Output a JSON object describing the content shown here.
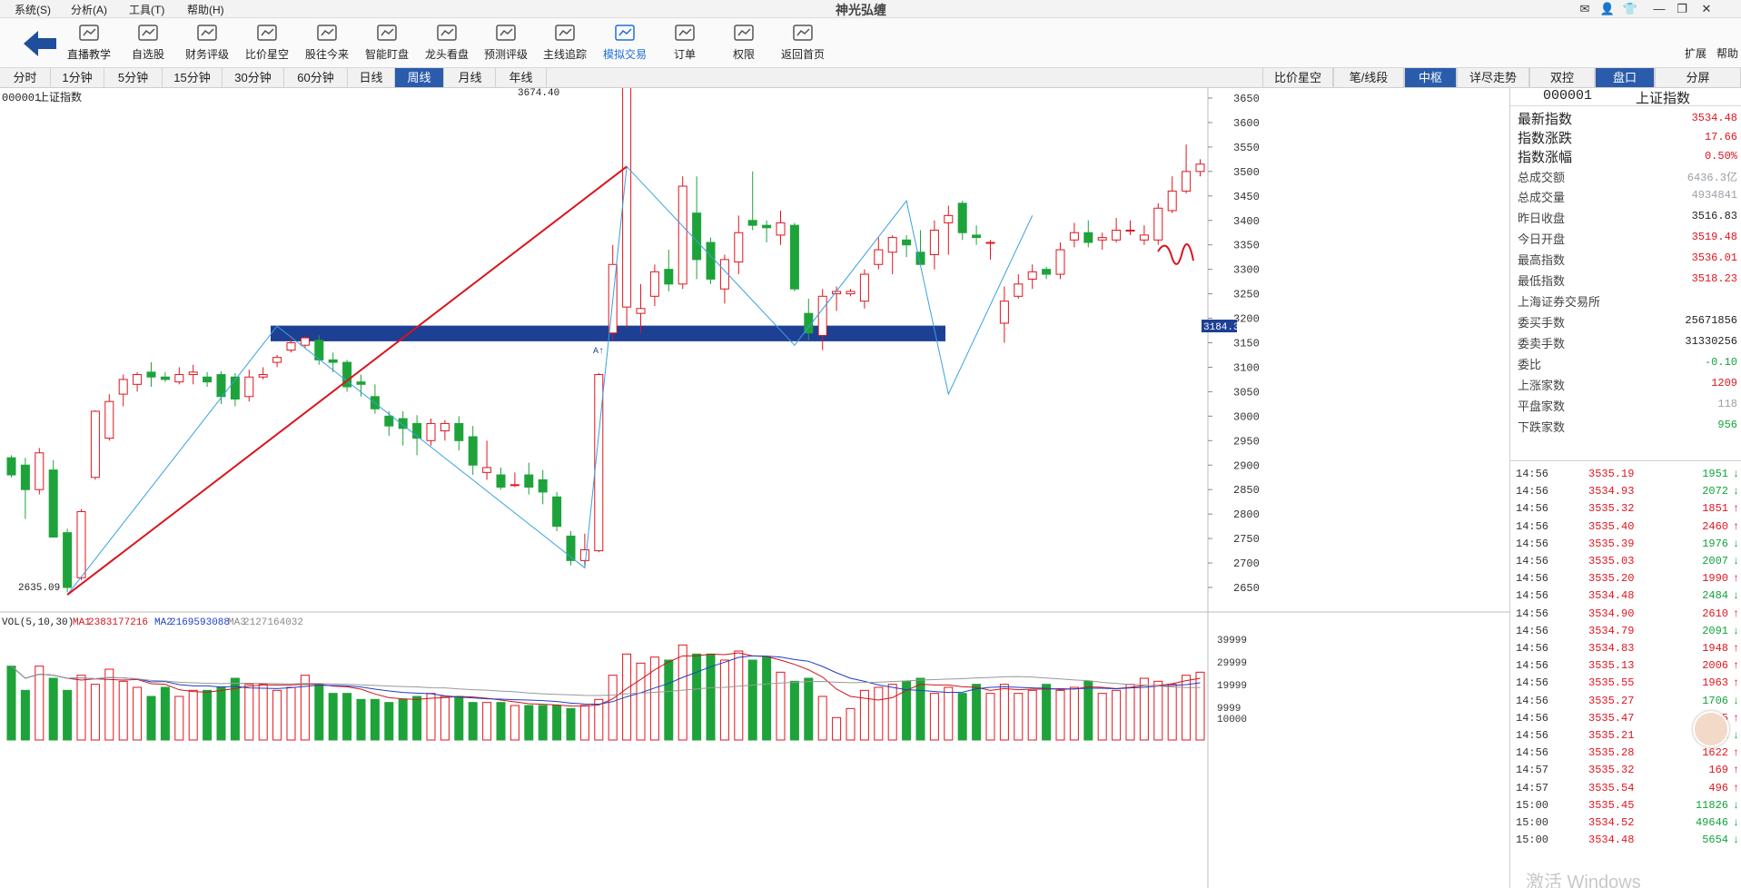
{
  "app": {
    "title": "神光弘缠"
  },
  "menu": {
    "items": [
      "系统(S)",
      "分析(A)",
      "工具(T)",
      "帮助(H)"
    ]
  },
  "toolbar": {
    "buttons": [
      {
        "label": "直播教学",
        "icon": "play-icon"
      },
      {
        "label": "自选股",
        "icon": "gauge-icon"
      },
      {
        "label": "财务评级",
        "icon": "plus-square-icon"
      },
      {
        "label": "比价星空",
        "icon": "line-chart-icon"
      },
      {
        "label": "股往今来",
        "icon": "cube-icon"
      },
      {
        "label": "智能盯盘",
        "icon": "bar-chart-icon"
      },
      {
        "label": "龙头看盘",
        "icon": "candles-icon"
      },
      {
        "label": "预测评级",
        "icon": "ai-icon"
      },
      {
        "label": "主线追踪",
        "icon": "target-icon"
      },
      {
        "label": "模拟交易",
        "icon": "swap-icon"
      },
      {
        "label": "订单",
        "icon": "document-icon"
      },
      {
        "label": "权限",
        "icon": "shield-icon"
      },
      {
        "label": "返回首页",
        "icon": "home-icon"
      }
    ],
    "active_index": 9,
    "right_items": [
      "扩展",
      "帮助"
    ]
  },
  "period_tabs": [
    "分时",
    "1分钟",
    "5分钟",
    "15分钟",
    "30分钟",
    "60分钟",
    "日线",
    "周线",
    "月线",
    "年线"
  ],
  "period_active": "周线",
  "right_tabs": [
    "比价星空",
    "笔/线段",
    "中枢",
    "详尽走势",
    "双控",
    "盘口",
    "分屏"
  ],
  "right_tabs_active": [
    "中枢",
    "盘口"
  ],
  "chart_header": {
    "code": "000001",
    "name": "上证指数"
  },
  "volume_header": {
    "label": "VOL(5,10,30)",
    "ma1_label": "MA1",
    "ma1": "2383177216",
    "ma2_label": "MA2",
    "ma2": "2169593088",
    "ma3_label": "MA3",
    "ma3": "2127164032"
  },
  "annotations": {
    "high": "3674.40",
    "low": "2635.09",
    "current_price_tag": "3184.3",
    "marker": "A↑"
  },
  "colors": {
    "up": "#e0151f",
    "down": "#1ea33a",
    "zhongshu": "#1d3f94",
    "bi_line": "#3aa0e0",
    "trend_line": "#d9151c",
    "active_tab": "#2a5cab"
  },
  "chart_data": {
    "type": "candlestick",
    "price_axis": {
      "ticks": [
        3650,
        3600,
        3550,
        3500,
        3450,
        3400,
        3350,
        3300,
        3250,
        3200,
        3150,
        3100,
        3050,
        3000,
        2950,
        2900,
        2850,
        2800,
        2750,
        2700,
        2650
      ]
    },
    "volume_axis": {
      "ticks": [
        "39999",
        "29999",
        "19999",
        "9999",
        "10000"
      ]
    },
    "zhongshu_band": [
      3153,
      3185
    ],
    "candles": [
      [
        2915,
        2880,
        2920,
        2875
      ],
      [
        2900,
        2850,
        2915,
        2790
      ],
      [
        2850,
        2925,
        2935,
        2840
      ],
      [
        2890,
        2753,
        2910,
        2752
      ],
      [
        2762,
        2650,
        2770,
        2640
      ],
      [
        2670,
        2805,
        2810,
        2665
      ],
      [
        2875,
        3010,
        3012,
        2870
      ],
      [
        2955,
        3030,
        3045,
        2950
      ],
      [
        3045,
        3075,
        3085,
        3020
      ],
      [
        3065,
        3085,
        3090,
        3050
      ],
      [
        3090,
        3080,
        3110,
        3060
      ],
      [
        3080,
        3075,
        3090,
        3070
      ],
      [
        3070,
        3085,
        3100,
        3065
      ],
      [
        3085,
        3090,
        3105,
        3065
      ],
      [
        3080,
        3070,
        3090,
        3060
      ],
      [
        3085,
        3040,
        3092,
        3025
      ],
      [
        3080,
        3035,
        3088,
        3020
      ],
      [
        3040,
        3080,
        3095,
        3030
      ],
      [
        3080,
        3085,
        3100,
        3075
      ],
      [
        3110,
        3120,
        3125,
        3100
      ],
      [
        3135,
        3150,
        3165,
        3130
      ],
      [
        3145,
        3160,
        3165,
        3140
      ],
      [
        3155,
        3115,
        3165,
        3105
      ],
      [
        3115,
        3110,
        3130,
        3090
      ],
      [
        3110,
        3060,
        3115,
        3050
      ],
      [
        3070,
        3065,
        3085,
        3040
      ],
      [
        3040,
        3015,
        3065,
        3005
      ],
      [
        3000,
        2980,
        3010,
        2960
      ],
      [
        2995,
        2975,
        3010,
        2940
      ],
      [
        2985,
        2955,
        3002,
        2920
      ],
      [
        2950,
        2985,
        2995,
        2940
      ],
      [
        2970,
        2985,
        2992,
        2950
      ],
      [
        2985,
        2950,
        3000,
        2930
      ],
      [
        2958,
        2900,
        2980,
        2880
      ],
      [
        2885,
        2895,
        2950,
        2870
      ],
      [
        2880,
        2855,
        2895,
        2850
      ],
      [
        2860,
        2860,
        2885,
        2855
      ],
      [
        2880,
        2855,
        2905,
        2840
      ],
      [
        2870,
        2845,
        2890,
        2820
      ],
      [
        2835,
        2775,
        2845,
        2765
      ],
      [
        2755,
        2705,
        2765,
        2695
      ],
      [
        2705,
        2727,
        2760,
        2690
      ],
      [
        2725,
        3085,
        3088,
        2722
      ],
      [
        3170,
        3310,
        3350,
        3155
      ],
      [
        3223,
        3674,
        3675,
        3180
      ],
      [
        3210,
        3220,
        3270,
        3170
      ],
      [
        3245,
        3295,
        3310,
        3225
      ],
      [
        3300,
        3270,
        3340,
        3255
      ],
      [
        3270,
        3470,
        3490,
        3260
      ],
      [
        3415,
        3320,
        3490,
        3280
      ],
      [
        3355,
        3280,
        3365,
        3270
      ],
      [
        3260,
        3320,
        3330,
        3230
      ],
      [
        3315,
        3375,
        3410,
        3290
      ],
      [
        3400,
        3390,
        3500,
        3380
      ],
      [
        3390,
        3385,
        3400,
        3355
      ],
      [
        3370,
        3395,
        3420,
        3350
      ],
      [
        3390,
        3260,
        3395,
        3255
      ],
      [
        3210,
        3170,
        3240,
        3155
      ],
      [
        3165,
        3245,
        3260,
        3135
      ],
      [
        3250,
        3255,
        3265,
        3215
      ],
      [
        3250,
        3255,
        3260,
        3245
      ],
      [
        3235,
        3290,
        3300,
        3220
      ],
      [
        3310,
        3340,
        3365,
        3300
      ],
      [
        3335,
        3365,
        3370,
        3290
      ],
      [
        3360,
        3350,
        3370,
        3325
      ],
      [
        3335,
        3310,
        3380,
        3315
      ],
      [
        3330,
        3380,
        3400,
        3300
      ],
      [
        3395,
        3410,
        3430,
        3330
      ],
      [
        3435,
        3375,
        3440,
        3360
      ],
      [
        3370,
        3365,
        3390,
        3350
      ],
      [
        3355,
        3355,
        3360,
        3320
      ],
      [
        3190,
        3235,
        3265,
        3150
      ],
      [
        3245,
        3270,
        3290,
        3240
      ],
      [
        3280,
        3295,
        3310,
        3260
      ],
      [
        3300,
        3290,
        3305,
        3280
      ],
      [
        3290,
        3340,
        3355,
        3280
      ],
      [
        3360,
        3375,
        3395,
        3345
      ],
      [
        3375,
        3355,
        3400,
        3345
      ],
      [
        3360,
        3365,
        3375,
        3340
      ],
      [
        3360,
        3380,
        3405,
        3355
      ],
      [
        3380,
        3380,
        3400,
        3370
      ],
      [
        3360,
        3370,
        3390,
        3350
      ],
      [
        3360,
        3425,
        3435,
        3350
      ],
      [
        3420,
        3460,
        3490,
        3415
      ],
      [
        3460,
        3500,
        3555,
        3455
      ],
      [
        3500,
        3515,
        3525,
        3490
      ]
    ],
    "volume": [
      29,
      21,
      29,
      25,
      21,
      26,
      23,
      28,
      24,
      22,
      19,
      22,
      19,
      21,
      21,
      22,
      25,
      23,
      23,
      21,
      22,
      26,
      23,
      20,
      20,
      18,
      18,
      17,
      18,
      19,
      20,
      19,
      19,
      17,
      17,
      17,
      16,
      16,
      16,
      16,
      15,
      16,
      18,
      26,
      33,
      30,
      32,
      31,
      36,
      33,
      33,
      31,
      34,
      31,
      32,
      27,
      24,
      25,
      19,
      12,
      15,
      21,
      22,
      23,
      24,
      25,
      20,
      22,
      20,
      23,
      20,
      23,
      20,
      21,
      23,
      21,
      22,
      24,
      20,
      21,
      23,
      25,
      24,
      23,
      26,
      27
    ],
    "ma_vol": {
      "ma1": "red",
      "ma2": "blue",
      "ma3": "gray"
    }
  },
  "right_panel": {
    "header": {
      "code": "000001",
      "name": "上证指数"
    },
    "stats": [
      {
        "label": "最新指数",
        "value": "3534.48",
        "cls": "red",
        "size": "big"
      },
      {
        "label": "指数涨跌",
        "value": "17.66",
        "cls": "red",
        "size": "big"
      },
      {
        "label": "指数涨幅",
        "value": "0.50%",
        "cls": "red",
        "size": "big"
      },
      {
        "label": "总成交额",
        "value": "6436.3亿",
        "cls": "gray",
        "size": "small"
      },
      {
        "label": "总成交量",
        "value": "4934841",
        "cls": "gray",
        "size": "small"
      },
      {
        "label": "昨日收盘",
        "value": "3516.83",
        "cls": "blk",
        "size": "small"
      },
      {
        "label": "今日开盘",
        "value": "3519.48",
        "cls": "red",
        "size": "small"
      },
      {
        "label": "最高指数",
        "value": "3536.01",
        "cls": "red",
        "size": "small"
      },
      {
        "label": "最低指数",
        "value": "3518.23",
        "cls": "red",
        "size": "small"
      },
      {
        "label": "上海证券交易所",
        "value": "",
        "cls": "blk",
        "size": "small"
      },
      {
        "label": "委买手数",
        "value": "25671856",
        "cls": "blk",
        "size": "small"
      },
      {
        "label": "委卖手数",
        "value": "31330256",
        "cls": "blk",
        "size": "small"
      },
      {
        "label": "委比",
        "value": "-0.10",
        "cls": "green",
        "size": "small"
      },
      {
        "label": "上涨家数",
        "value": "1209",
        "cls": "red",
        "size": "small"
      },
      {
        "label": "平盘家数",
        "value": "118",
        "cls": "gray",
        "size": "small"
      },
      {
        "label": "下跌家数",
        "value": "956",
        "cls": "green",
        "size": "small"
      }
    ],
    "ticks": [
      {
        "time": "14:56",
        "price": "3535.19",
        "vol": "1951",
        "dir": "down"
      },
      {
        "time": "14:56",
        "price": "3534.93",
        "vol": "2072",
        "dir": "down"
      },
      {
        "time": "14:56",
        "price": "3535.32",
        "vol": "1851",
        "dir": "up"
      },
      {
        "time": "14:56",
        "price": "3535.40",
        "vol": "2460",
        "dir": "up"
      },
      {
        "time": "14:56",
        "price": "3535.39",
        "vol": "1976",
        "dir": "down"
      },
      {
        "time": "14:56",
        "price": "3535.03",
        "vol": "2007",
        "dir": "down"
      },
      {
        "time": "14:56",
        "price": "3535.20",
        "vol": "1990",
        "dir": "up"
      },
      {
        "time": "14:56",
        "price": "3534.48",
        "vol": "2484",
        "dir": "down"
      },
      {
        "time": "14:56",
        "price": "3534.90",
        "vol": "2610",
        "dir": "up"
      },
      {
        "time": "14:56",
        "price": "3534.79",
        "vol": "2091",
        "dir": "down"
      },
      {
        "time": "14:56",
        "price": "3534.83",
        "vol": "1948",
        "dir": "up"
      },
      {
        "time": "14:56",
        "price": "3535.13",
        "vol": "2006",
        "dir": "up"
      },
      {
        "time": "14:56",
        "price": "3535.55",
        "vol": "1963",
        "dir": "up"
      },
      {
        "time": "14:56",
        "price": "3535.27",
        "vol": "1706",
        "dir": "down"
      },
      {
        "time": "14:56",
        "price": "3535.47",
        "vol": "2005",
        "dir": "up"
      },
      {
        "time": "14:56",
        "price": "3535.21",
        "vol": "1",
        "dir": "down"
      },
      {
        "time": "14:56",
        "price": "3535.28",
        "vol": "1622",
        "dir": "up"
      },
      {
        "time": "14:57",
        "price": "3535.32",
        "vol": "169",
        "dir": "up"
      },
      {
        "time": "14:57",
        "price": "3535.54",
        "vol": "496",
        "dir": "up"
      },
      {
        "time": "15:00",
        "price": "3535.45",
        "vol": "11826",
        "dir": "down"
      },
      {
        "time": "15:00",
        "price": "3534.52",
        "vol": "49646",
        "dir": "down"
      },
      {
        "time": "15:00",
        "price": "3534.48",
        "vol": "5654",
        "dir": "down"
      }
    ]
  },
  "watermark": "激活 Windows"
}
